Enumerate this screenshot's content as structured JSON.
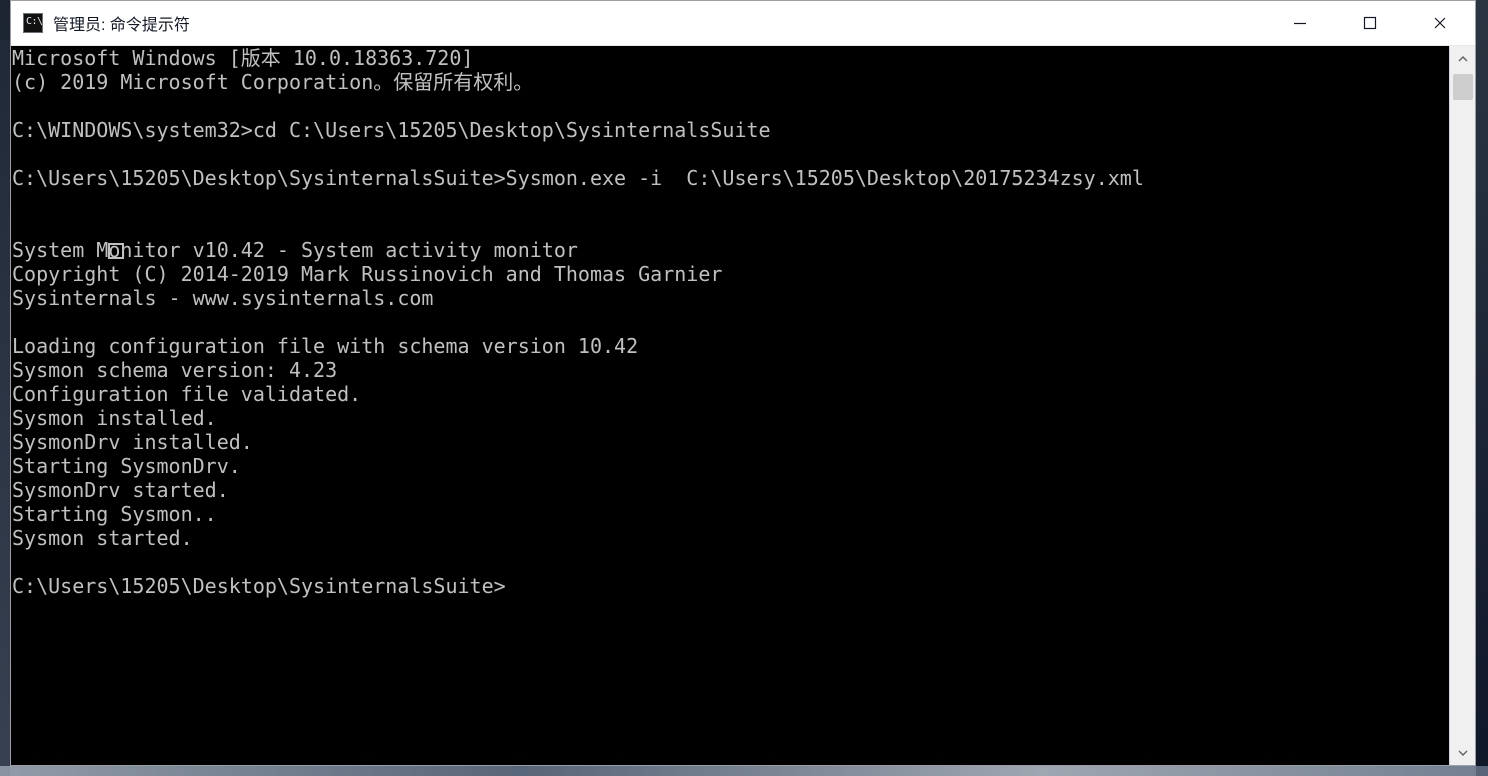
{
  "window": {
    "title": "管理员: 命令提示符",
    "icon_text": "C:\\",
    "controls": {
      "minimize_icon": "minimize-icon",
      "maximize_icon": "maximize-icon",
      "close_icon": "close-icon"
    }
  },
  "console": {
    "lines": [
      "Microsoft Windows [版本 10.0.18363.720]",
      "(c) 2019 Microsoft Corporation。保留所有权利。",
      "",
      "C:\\WINDOWS\\system32>cd C:\\Users\\15205\\Desktop\\SysinternalsSuite",
      "",
      "C:\\Users\\15205\\Desktop\\SysinternalsSuite>Sysmon.exe -i  C:\\Users\\15205\\Desktop\\20175234zsy.xml",
      "",
      "",
      "System Monitor v10.42 - System activity monitor",
      "Copyright (C) 2014-2019 Mark Russinovich and Thomas Garnier",
      "Sysinternals - www.sysinternals.com",
      "",
      "Loading configuration file with schema version 10.42",
      "Sysmon schema version: 4.23",
      "Configuration file validated.",
      "Sysmon installed.",
      "SysmonDrv installed.",
      "Starting SysmonDrv.",
      "SysmonDrv started.",
      "Starting Sysmon..",
      "Sysmon started.",
      "",
      "C:\\Users\\15205\\Desktop\\SysinternalsSuite>"
    ],
    "cursor_box_line_index": 7
  },
  "colors": {
    "console_bg": "#000000",
    "console_fg": "#c0c0c0",
    "titlebar_bg": "#ffffff",
    "window_border": "#9aa0a6",
    "scrollbar_bg": "#f0f0f0",
    "scrollbar_thumb": "#cdcdcd"
  },
  "scrollbar": {
    "up_icon": "scroll-up-icon",
    "down_icon": "scroll-down-icon"
  }
}
